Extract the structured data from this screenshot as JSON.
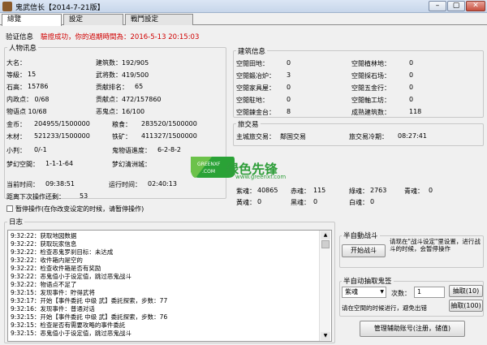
{
  "window": {
    "title": "鬼武信长【2014-7-21版】",
    "minimize": "–",
    "maximize": "▢",
    "close": "✕"
  },
  "tabs": [
    {
      "label": "總覽"
    },
    {
      "label": "設定"
    },
    {
      "label": "戰鬥設定"
    }
  ],
  "verify": {
    "label": "验证信息",
    "message": "驗證成功，你的過期時間為：2016-5-13 20:15:03"
  },
  "person": {
    "legend": "人物讯息",
    "name": "大名：",
    "buildings": "建筑数：192/905",
    "level_label": "等級：",
    "level_value": "15",
    "martial": "武将数：419/500",
    "stone_label": "石高：",
    "stone_value": "15786",
    "contrib_rank_label": "贡献排名：",
    "contrib_rank_value": "65",
    "politics": "内政点： 0/68",
    "contribution": "贡献点：472/157860",
    "story": "物语点 10/68",
    "evil_ghost": "恶鬼点：16/100",
    "gold_label": "金币：",
    "gold_value": "204955/1500000",
    "food_label": "粮食：",
    "food_value": "283520/1500000",
    "wood_label": "木材：",
    "wood_value": "521233/1500000",
    "iron_label": "铁矿：",
    "iron_value": "411327/1500000",
    "small_judge_label": "小判：",
    "small_judge_value": "0/-1",
    "ghost_story_label": "鬼物语進度：",
    "ghost_story_value": "6-2-8-2",
    "dream_label": "梦幻空間：",
    "dream_value": "1-1-1-64",
    "dream_castle_label": "梦幻清洲城："
  },
  "time": {
    "current_label": "当前时间：",
    "current_value": "09:38:51",
    "run_label": "运行时间：",
    "run_value": "02:40:13",
    "next_label": "距离下次操作还剩：",
    "next_value": "53",
    "pause_label": "暂停操作(在你改变设定的时候，请暂停操作)"
  },
  "buildings": {
    "legend": "建筑信息",
    "rows": [
      {
        "l1": "空閒田地：",
        "v1": "0",
        "l2": "空閒植林地：",
        "v2": "0"
      },
      {
        "l1": "空閒鍛冶炉：",
        "v1": "3",
        "l2": "空閒採石场：",
        "v2": "0"
      },
      {
        "l1": "空閒家具屋：",
        "v1": "0",
        "l2": "空閒五金行：",
        "v2": "0"
      },
      {
        "l1": "空閒駐地：",
        "v1": "0",
        "l2": "空閒軸工坊：",
        "v2": "0"
      },
      {
        "l1": "空閒鍊金台：",
        "v1": "8",
        "l2": "成熟建筑数：",
        "v2": "118"
      }
    ]
  },
  "trade": {
    "legend": "旅交易",
    "main_label": "主城旅交易：",
    "main_value": "鄰国交易",
    "time_label": "旅交易冷期：",
    "time_value": "08:27:41"
  },
  "souls": {
    "row1": [
      {
        "l": "紫魂：",
        "v": "40865"
      },
      {
        "l": "赤魂：",
        "v": "115"
      },
      {
        "l": "綠魂：",
        "v": "2763"
      },
      {
        "l": "青魂：",
        "v": "0"
      }
    ],
    "row2": [
      {
        "l": "黃魂：",
        "v": "0"
      },
      {
        "l": "黑魂：",
        "v": "0"
      },
      {
        "l": "白魂：",
        "v": "0"
      }
    ]
  },
  "log": {
    "legend": "日志",
    "lines": [
      "9:32:22：获取地図数据",
      "9:32:22：获取玩家信息",
      "9:32:22：检查恶鬼罗刹目标：未达成",
      "9:32:22：收件箱内是空的",
      "9:32:22：检查收件箱是否有奖励",
      "9:32:22：恶鬼值小于设定值，跳过恶鬼战斗",
      "9:32:22：物语点不足了",
      "9:32:15：发现事件：貯得武将",
      "9:32:17：开始【事件委託 中级 武】委託探索，步数：77",
      "9:32:16：发现事件：普通对话",
      "9:32:15：开始【事件委託 中级 武】委託探索，步数：76",
      "9:32:15：检查是否有需要攻略的事件委託",
      "9:32:15：恶鬼值小于设定值，跳过恶鬼战斗"
    ]
  },
  "battle": {
    "legend": "半自動战斗",
    "start_button": "开始战斗",
    "note": "请现在\"战斗设定\"里设置，进行战斗的时候，会暂停操作"
  },
  "draw": {
    "legend": "半自动抽取鬼签",
    "type_value": "紫魂",
    "count_label": "次数：",
    "count_value": "1",
    "draw10_button": "抽取(10)",
    "draw100_button": "抽取(100)",
    "note": "请在空間的时候进行，避免出错"
  },
  "manage_button": "管理辅助账号(注册，储值)",
  "watermark": {
    "brand": "绿色先锋",
    "site": "www.greenxf.com",
    "badge_top": "GREENXF",
    "badge_bottom": ".COM"
  }
}
